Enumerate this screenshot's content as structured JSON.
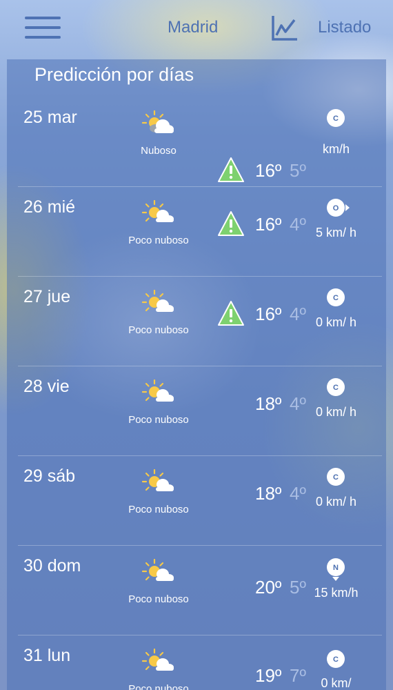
{
  "header": {
    "menu_icon": "hamburger-menu-icon",
    "city": "Madrid",
    "chart_icon": "line-chart-icon",
    "list_label": "Listado"
  },
  "forecast": {
    "title": "Predicción por días",
    "days": [
      {
        "date": "25 mar",
        "sky": "Nuboso",
        "sky_icon": "cloudy-sun-icon",
        "warning": true,
        "tmax": "16º",
        "tmin": "5º",
        "wind_dir": "C",
        "wind": "km/h"
      },
      {
        "date": "26 mié",
        "sky": "Poco nuboso",
        "sky_icon": "partly-cloudy-icon",
        "warning": true,
        "tmax": "16º",
        "tmin": "4º",
        "wind_dir": "O",
        "wind": "5 km/ h"
      },
      {
        "date": "27 jue",
        "sky": "Poco nuboso",
        "sky_icon": "partly-cloudy-icon",
        "warning": true,
        "tmax": "16º",
        "tmin": "4º",
        "wind_dir": "C",
        "wind": "0 km/ h"
      },
      {
        "date": "28 vie",
        "sky": "Poco nuboso",
        "sky_icon": "partly-cloudy-icon",
        "warning": false,
        "tmax": "18º",
        "tmin": "4º",
        "wind_dir": "C",
        "wind": "0 km/ h"
      },
      {
        "date": "29 sáb",
        "sky": "Poco nuboso",
        "sky_icon": "partly-cloudy-icon",
        "warning": false,
        "tmax": "18º",
        "tmin": "4º",
        "wind_dir": "C",
        "wind": "0 km/ h"
      },
      {
        "date": "30 dom",
        "sky": "Poco nuboso",
        "sky_icon": "partly-cloudy-icon",
        "warning": false,
        "tmax": "20º",
        "tmin": "5º",
        "wind_dir": "N",
        "wind": "15 km/h"
      },
      {
        "date": "31 lun",
        "sky": "Poco nuboso",
        "sky_icon": "partly-cloudy-icon",
        "warning": false,
        "tmax": "19º",
        "tmin": "7º",
        "wind_dir": "C",
        "wind": "0 km/"
      }
    ]
  },
  "colors": {
    "accent": "#4e72b3",
    "warning": "#7ed16f",
    "min_temp": "#a9bde3"
  }
}
